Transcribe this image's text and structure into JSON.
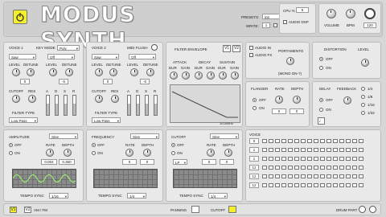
{
  "header": {
    "title": "MODUS SYNTH",
    "presets_label": "PRESETS:",
    "preset_value": "init",
    "write_label": "WRITE:",
    "write_value": "1",
    "cpu_label": "CPU %",
    "cpu_value": "5",
    "audio_dsp_label": "AUDIO DSP",
    "volume_label": "VOLUME",
    "bpm_label": "BPM",
    "bpm_value": "120"
  },
  "voice1": {
    "title": "VOICE 1",
    "keymode_label": "KEY MODE",
    "keymode_value": "Poly",
    "wave1": "Saw",
    "wave2": "Off",
    "level1": "LEVEL",
    "detune1": "DETUNE",
    "level2": "LEVEL",
    "detune2": "DETUNE",
    "oct1": "0",
    "oct2": "-5",
    "cutoff": "CUTOFF",
    "res": "RES",
    "a": "A",
    "d": "D",
    "s": "S",
    "r": "R",
    "filter_type_label": "FILTER TYPE",
    "filter_type": "Low Pass"
  },
  "voice2": {
    "title": "VOICE 2",
    "midi_flush": "MIDI FLUSH",
    "wave1": "Saw",
    "wave2": "Off",
    "level1": "LEVEL",
    "detune1": "DETUNE",
    "level2": "LEVEL",
    "detune2": "DETUNE",
    "oct1": "0",
    "oct2": "-5",
    "cutoff": "CUTOFF",
    "res": "RES",
    "a": "A",
    "d": "D",
    "s": "S",
    "r": "R",
    "filter_type_label": "FILTER TYPE",
    "filter_type": "Low Pass"
  },
  "filter_env": {
    "title": "FILTER ENVELOPE",
    "v1": "V1",
    "v2": "V2",
    "attack": "ATTACK",
    "decay": "DECAY",
    "sustain": "SUSTAIN",
    "dur": "DUR",
    "gain": "GAIN",
    "freq_label": "10,000Hz"
  },
  "audio_in": {
    "audio_in": "AUDIO IN",
    "audio_fx": "AUDIO FX",
    "portamento": "PORTAMENTO",
    "mono_label": "(MONO ON-?)"
  },
  "distortion": {
    "title": "DISTORTION",
    "level": "LEVEL",
    "off": "OFF",
    "on": "ON"
  },
  "flanger": {
    "title": "FLANGER",
    "rate": "RATE",
    "depth": "DEPTH",
    "off": "OFF",
    "on": "ON",
    "val1": "0",
    "val2": "0"
  },
  "delay": {
    "title": "DELAY",
    "feedback": "FEEDBACK",
    "off": "OFF",
    "on": "ON",
    "opt1": "1/4",
    "opt2": "1/8",
    "opt3": "1/16",
    "opt4": "1/32"
  },
  "amplitude": {
    "title": "AMPLITUDE",
    "wave": "Sine",
    "off": "OFF",
    "on": "ON",
    "rate": "RATE",
    "depth": "DEPTH",
    "rate_val": "0.004",
    "depth_val": "0.360",
    "tempo_sync": "TEMPO SYNC",
    "tempo_val": "1/16"
  },
  "frequency": {
    "title": "FREQUENCY",
    "wave": "Sine",
    "off": "OFF",
    "on": "ON",
    "rate": "RATE",
    "depth": "DEPTH",
    "rate_val": "0",
    "depth_val": "0",
    "tempo_sync": "TEMPO SYNC",
    "tempo_val": "1/4"
  },
  "cutoff_lfo": {
    "title": "CUTOFF",
    "wave": "Sine",
    "off": "OFF",
    "on": "ON",
    "rate": "RATE",
    "depth": "DEPTH",
    "mode": "LP",
    "rate_val": "0",
    "depth_val": "0",
    "tempo_sync": "TEMPO SYNC",
    "tempo_val": "1/4"
  },
  "sequencer": {
    "title": "VOICE",
    "rows": [
      "0",
      "1",
      "1",
      "12",
      "12",
      "12"
    ],
    "drum_part": "DRUM PART"
  },
  "footer": {
    "v1": "V1",
    "v2": "V2",
    "am_fm": "AM / FM",
    "panning": "PANNING",
    "cutoff": "CUTOFF"
  },
  "colors": {
    "accent_yellow": "#f4ef2a",
    "panel": "#e9e9e9",
    "background": "#d7d7d7"
  }
}
